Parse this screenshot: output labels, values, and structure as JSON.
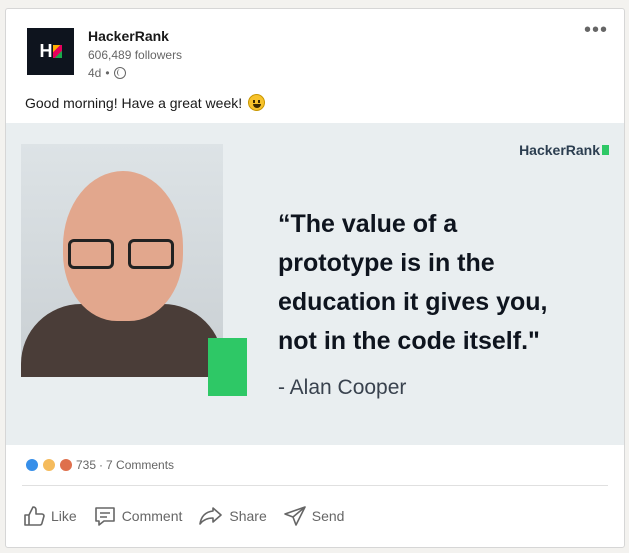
{
  "post": {
    "author": "HackerRank",
    "followers": "606,489 followers",
    "time": "4d",
    "visibility_sep": "•",
    "logo_letter": "H",
    "text": "Good morning! Have a great week!",
    "more": "•••"
  },
  "banner": {
    "brand": "HackerRank",
    "quote_lines": [
      "“The value of a",
      "prototype is in the",
      "education it gives you,",
      "not in the code itself.\""
    ],
    "author": "- Alan Cooper",
    "colors": {
      "green": "#2ec866",
      "background": "#e9eef0",
      "text": "#0e141e"
    }
  },
  "social": {
    "count": "735",
    "sep": "·",
    "comments": "7 Comments"
  },
  "actions": {
    "like": "Like",
    "comment": "Comment",
    "share": "Share",
    "send": "Send"
  }
}
